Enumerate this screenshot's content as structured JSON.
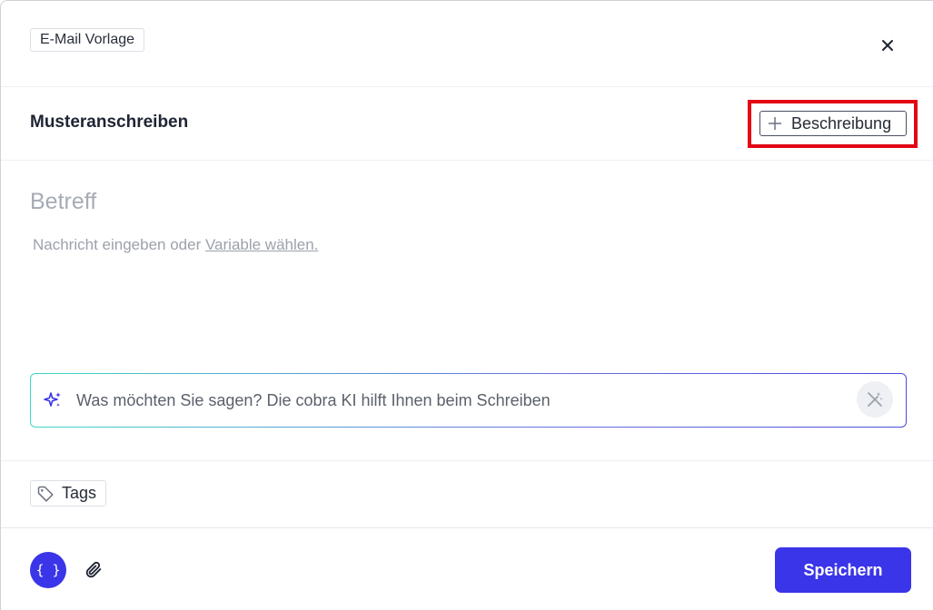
{
  "header": {
    "type_badge": "E-Mail Vorlage",
    "close_icon": "close-icon"
  },
  "template": {
    "title": "Musteranschreiben",
    "add_description_label": "Beschreibung"
  },
  "editor": {
    "subject_placeholder": "Betreff",
    "message_prefix": "Nachricht eingeben oder ",
    "message_link": "Variable wählen."
  },
  "ai_assistant": {
    "placeholder": "Was möchten Sie sagen? Die cobra KI hilft Ihnen beim Schreiben",
    "sparkle_icon": "sparkle-icon",
    "wand_icon": "magic-wand-icon"
  },
  "tags": {
    "label": "Tags",
    "icon": "tag-icon"
  },
  "footer": {
    "variables_label": "{ }",
    "attach_icon": "paperclip-icon",
    "save_label": "Speichern"
  },
  "colors": {
    "primary": "#3a35e8",
    "highlight": "#e30613",
    "ai_gradient_start": "#3fd9c7",
    "ai_gradient_end": "#4b4bdd"
  }
}
